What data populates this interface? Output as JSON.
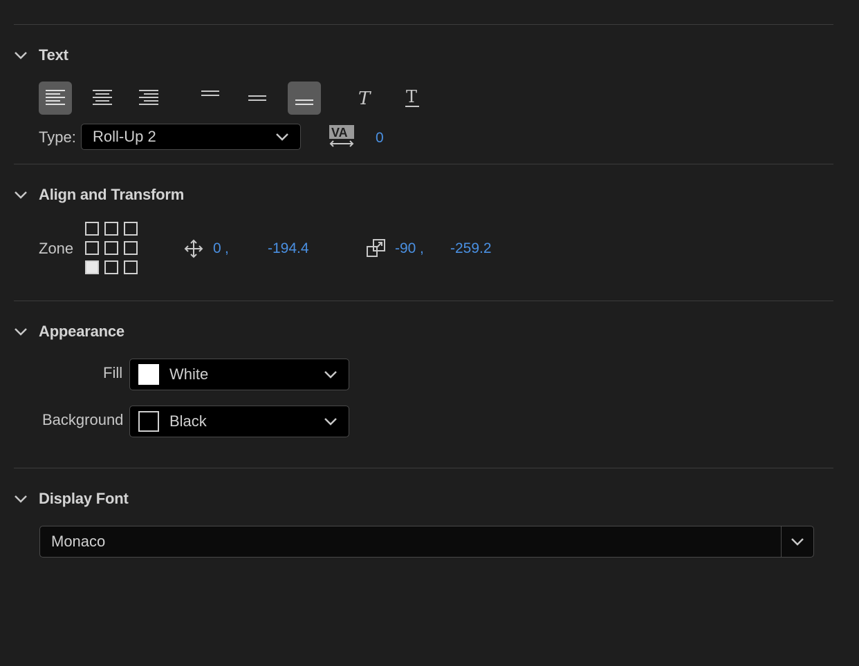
{
  "sections": {
    "text": {
      "title": "Text",
      "type_label": "Type:",
      "type_value": "Roll-Up 2",
      "tracking_value": "0",
      "buttons": [
        {
          "name": "align-left",
          "active": true
        },
        {
          "name": "align-center",
          "active": false
        },
        {
          "name": "align-right",
          "active": false
        },
        {
          "name": "position-top",
          "active": false
        },
        {
          "name": "position-middle",
          "active": false
        },
        {
          "name": "position-bottom",
          "active": true
        },
        {
          "name": "italic",
          "active": false
        },
        {
          "name": "underline",
          "active": false
        }
      ]
    },
    "align": {
      "title": "Align and Transform",
      "zone_label": "Zone",
      "zone_selected": "bottom-left",
      "pos_x": "0",
      "pos_sep": ",",
      "pos_y": "-194.4",
      "size_x": "-90",
      "size_sep": ",",
      "size_y": "-259.2"
    },
    "appearance": {
      "title": "Appearance",
      "fill_label": "Fill",
      "fill_value": "White",
      "fill_color": "#ffffff",
      "background_label": "Background",
      "background_value": "Black",
      "background_color": "#000000"
    },
    "font": {
      "title": "Display Font",
      "value": "Monaco"
    }
  },
  "colors": {
    "panel_bg": "#1e1e1e",
    "accent_blue": "#4a90e2",
    "active_button": "#5a5a5a"
  }
}
